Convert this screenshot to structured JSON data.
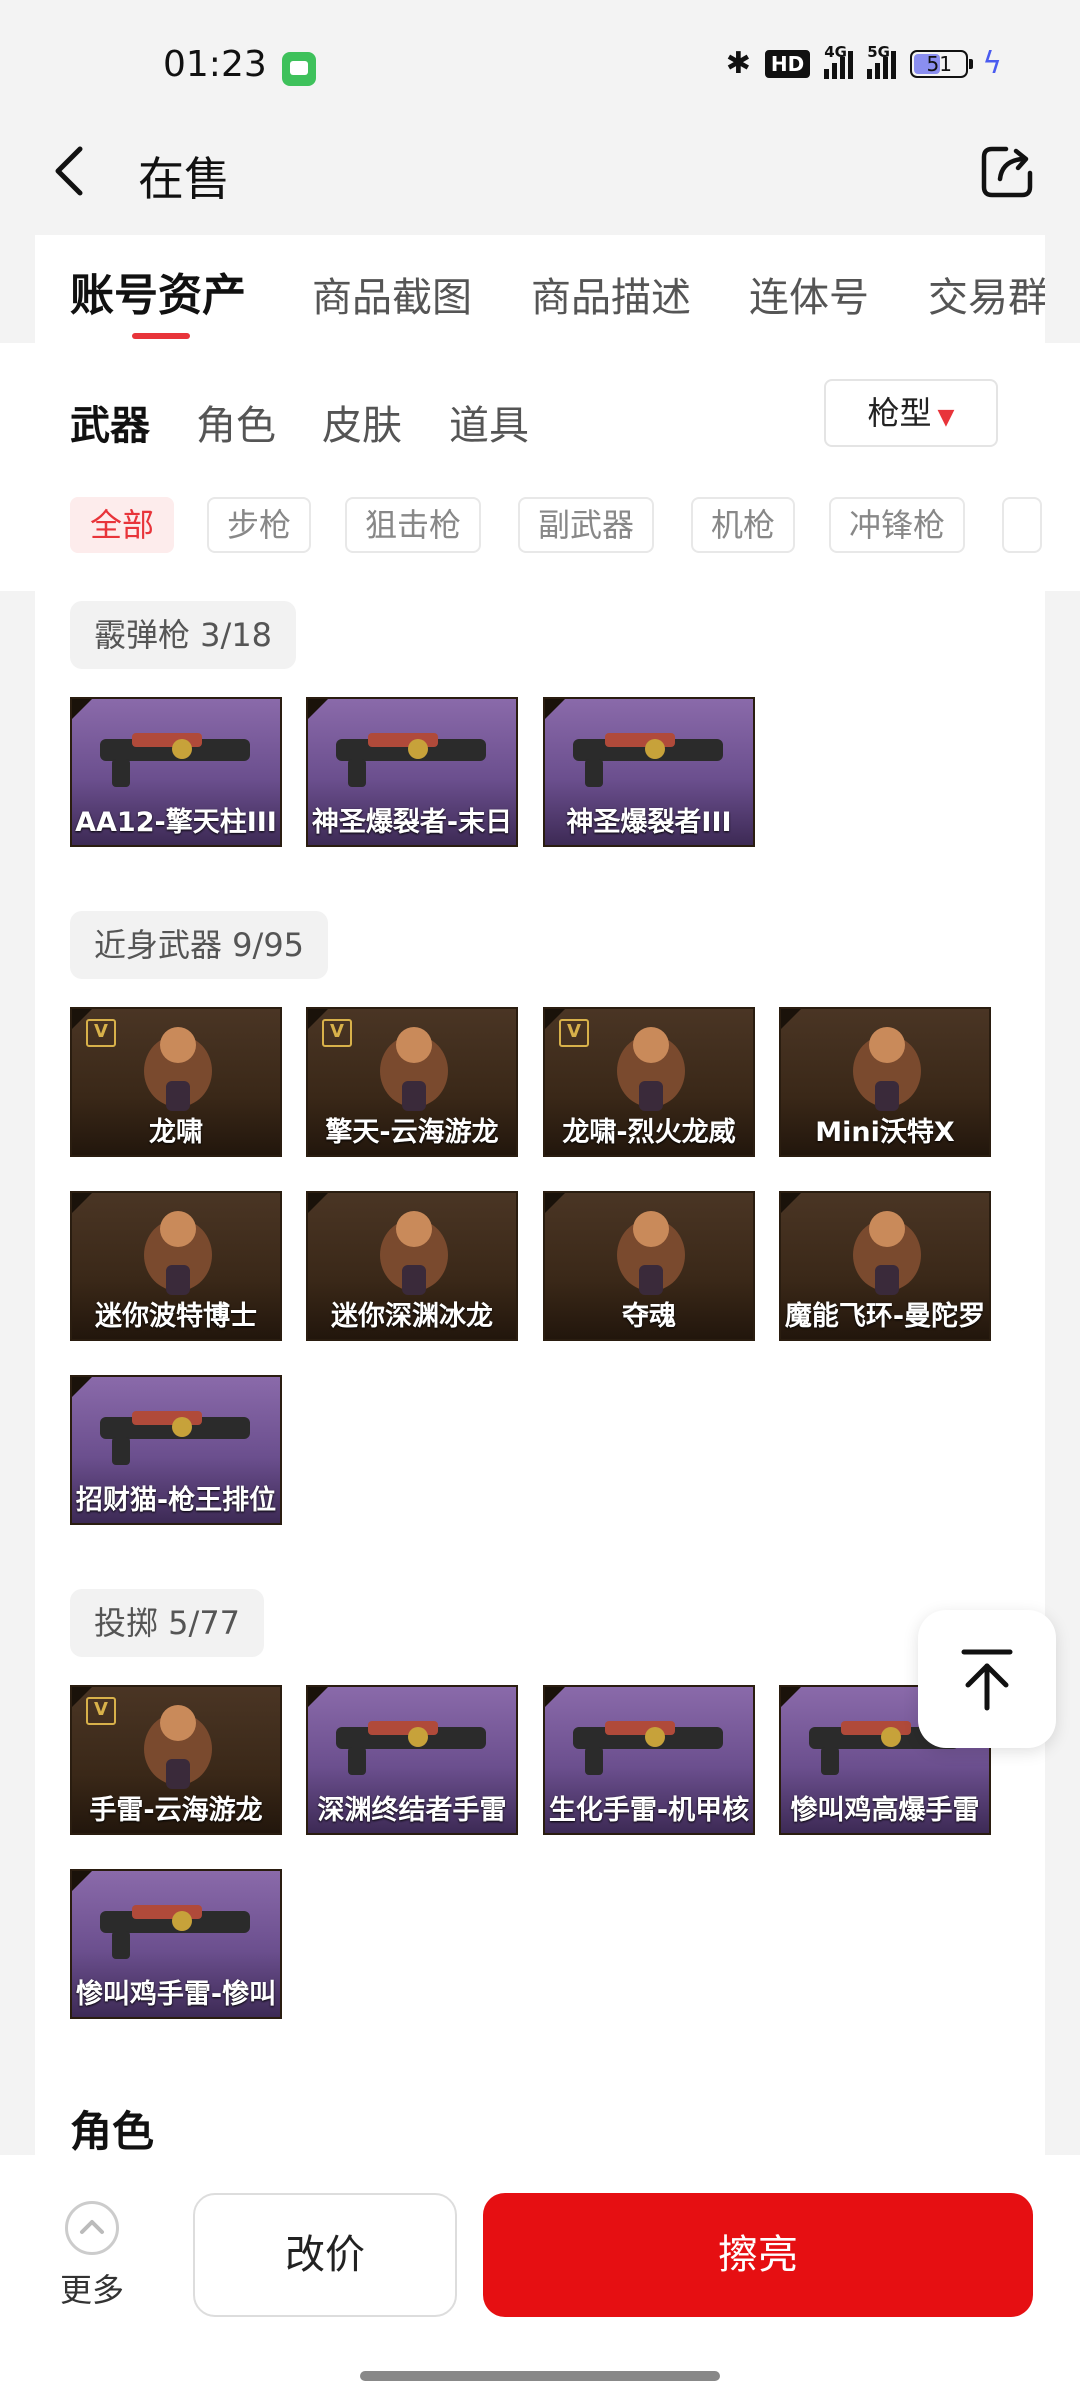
{
  "status_bar": {
    "time": "01:23",
    "hd": "HD",
    "net1": "4G",
    "net2": "5G",
    "battery": "51",
    "battery_level": 0.51
  },
  "header": {
    "title": "在售"
  },
  "tabs": [
    "账号资产",
    "商品截图",
    "商品描述",
    "连体号",
    "交易群"
  ],
  "categories": [
    "武器",
    "角色",
    "皮肤",
    "道具"
  ],
  "gun_type_button": "枪型",
  "filter_chips": [
    "全部",
    "步枪",
    "狙击枪",
    "副武器",
    "机枪",
    "冲锋枪"
  ],
  "groups": [
    {
      "label": "霰弹枪 3/18",
      "items": [
        {
          "name": "AA12-擎天柱III",
          "bg": "purple"
        },
        {
          "name": "神圣爆裂者-末日",
          "bg": "purple"
        },
        {
          "name": "神圣爆裂者III",
          "bg": "purple"
        }
      ]
    },
    {
      "label": "近身武器 9/95",
      "items": [
        {
          "name": "龙啸",
          "bg": "brown",
          "badge": "V"
        },
        {
          "name": "擎天-云海游龙",
          "bg": "brown",
          "badge": "V"
        },
        {
          "name": "龙啸-烈火龙威",
          "bg": "brown",
          "badge": "V"
        },
        {
          "name": "Mini沃特X",
          "bg": "brown"
        },
        {
          "name": "迷你波特博士",
          "bg": "brown"
        },
        {
          "name": "迷你深渊冰龙",
          "bg": "brown"
        },
        {
          "name": "夺魂",
          "bg": "brown"
        },
        {
          "name": "魔能飞环-曼陀罗",
          "bg": "brown"
        },
        {
          "name": "招财猫-枪王排位",
          "bg": "purple"
        }
      ]
    },
    {
      "label": "投掷 5/77",
      "items": [
        {
          "name": "手雷-云海游龙",
          "bg": "brown",
          "badge": "V"
        },
        {
          "name": "深渊终结者手雷",
          "bg": "purple"
        },
        {
          "name": "生化手雷-机甲核",
          "bg": "purple"
        },
        {
          "name": "惨叫鸡高爆手雷",
          "bg": "purple"
        },
        {
          "name": "惨叫鸡手雷-惨叫",
          "bg": "purple"
        }
      ]
    }
  ],
  "section_next": "角色",
  "bottom_bar": {
    "more": "更多",
    "reprice": "改价",
    "polish": "擦亮"
  },
  "colors": {
    "accent": "#e60f12",
    "tab_indicator": "#e8343a",
    "item_purple": "#6b4f8e",
    "item_brown": "#3a2818"
  }
}
